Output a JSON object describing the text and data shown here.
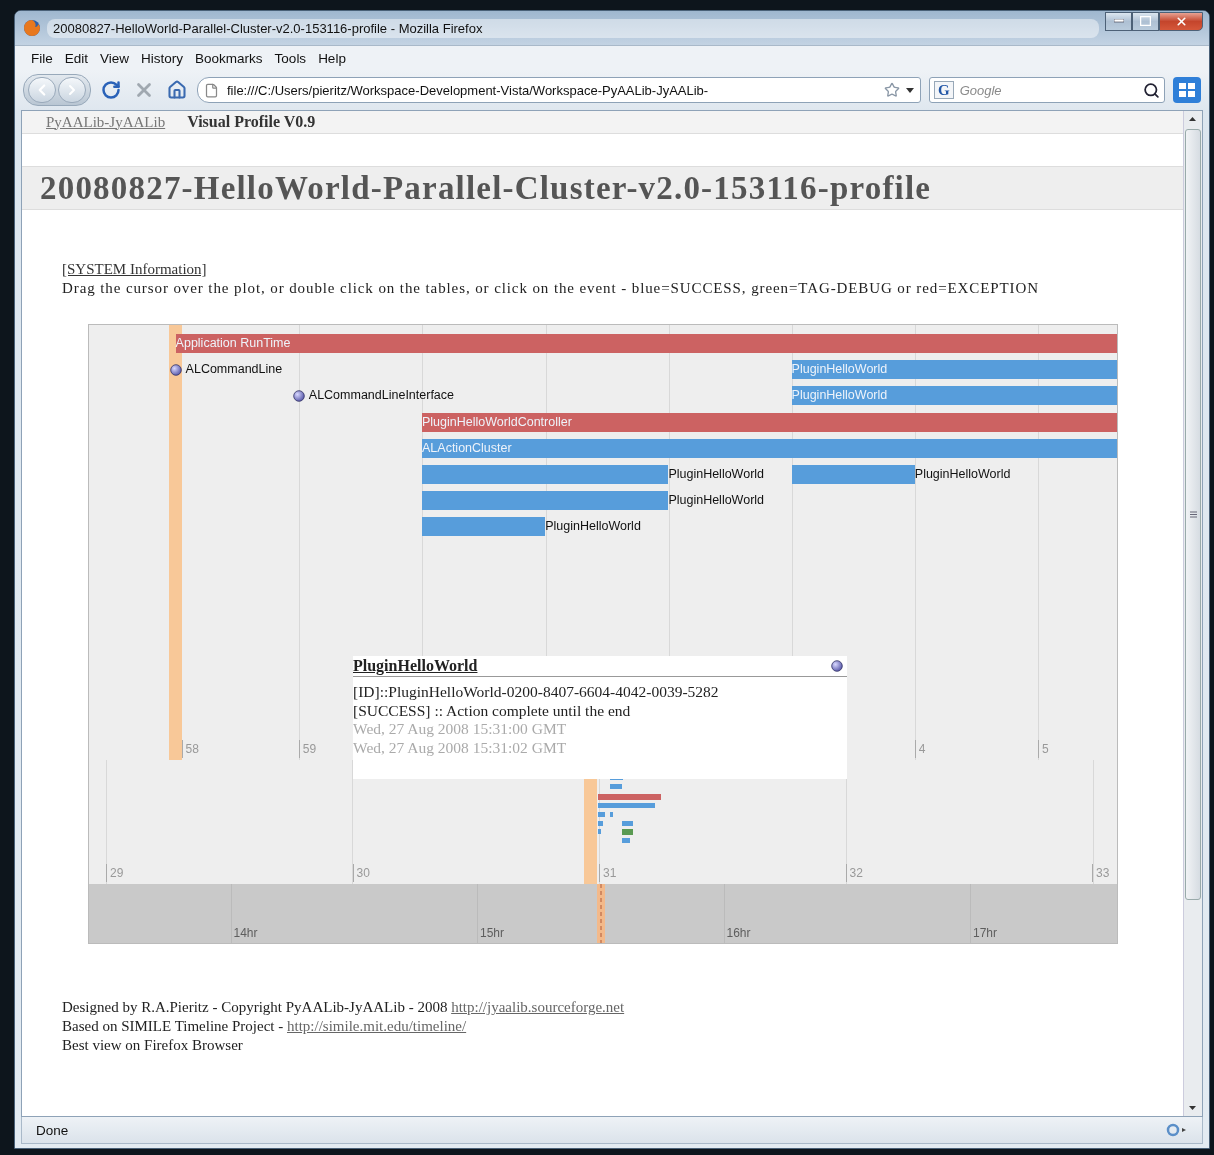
{
  "window": {
    "title": "20080827-HelloWorld-Parallel-Cluster-v2.0-153116-profile - Mozilla Firefox"
  },
  "menu": [
    "File",
    "Edit",
    "View",
    "History",
    "Bookmarks",
    "Tools",
    "Help"
  ],
  "navigation": {
    "url": "file:///C:/Users/pieritz/Workspace-Development-Vista/Workspace-PyAALib-JyAALib-",
    "search_engine": "G",
    "search_placeholder": "Google"
  },
  "page": {
    "nav_link": "PyAALib-JyAALib",
    "nav_title": "Visual Profile V0.9",
    "heading": "20080827-HelloWorld-Parallel-Cluster-v2.0-153116-profile",
    "system_link": "[SYSTEM Information]",
    "instructions": "Drag the cursor over the plot, or double click on the tables, or click on the event - blue=SUCCESS, green=TAG-DEBUG or red=EXCEPTION",
    "timeline": {
      "tracks": [
        {
          "events": [
            {
              "kind": "duration",
              "label": "Application RunTime",
              "color": "#cc6262"
            }
          ]
        },
        {
          "events": [
            {
              "kind": "instant",
              "label": "ALCommandLine"
            },
            {
              "kind": "duration",
              "label": "PluginHelloWorld",
              "color": "#579ddb"
            }
          ]
        },
        {
          "events": [
            {
              "kind": "instant",
              "label": "ALCommandLineInterface"
            },
            {
              "kind": "duration",
              "label": "PluginHelloWorld",
              "color": "#579ddb"
            }
          ]
        },
        {
          "events": [
            {
              "kind": "duration",
              "label": "PluginHelloWorldController",
              "color": "#cc6262"
            }
          ]
        },
        {
          "events": [
            {
              "kind": "duration",
              "label": "ALActionCluster",
              "color": "#579ddb"
            }
          ]
        },
        {
          "events": [
            {
              "kind": "duration",
              "label": "PluginHelloWorld",
              "color": "#579ddb"
            },
            {
              "kind": "duration",
              "label": "PluginHelloWorld",
              "color": "#579ddb"
            }
          ]
        },
        {
          "events": [
            {
              "kind": "duration",
              "label": "PluginHelloWorld",
              "color": "#579ddb"
            }
          ]
        },
        {
          "events": [
            {
              "kind": "duration",
              "label": "PluginHelloWorld",
              "color": "#579ddb"
            }
          ]
        }
      ],
      "second_ticks": [
        "58",
        "59",
        "4",
        "5"
      ],
      "minute_ticks": [
        "29",
        "30",
        "31",
        "32",
        "33"
      ],
      "hour_ticks": [
        "14hr",
        "15hr",
        "16hr",
        "17hr"
      ],
      "popup": {
        "title": "PluginHelloWorld",
        "lines": [
          {
            "kind": "detail",
            "text": "[ID]::PluginHelloWorld-0200-8407-6604-4042-0039-5282"
          },
          {
            "kind": "detail",
            "text": "[SUCCESS] :: Action complete until the end"
          },
          {
            "kind": "date",
            "text": "Wed, 27 Aug 2008 15:31:00 GMT"
          },
          {
            "kind": "date",
            "text": "Wed, 27 Aug 2008 15:31:02 GMT"
          }
        ]
      }
    },
    "footer": [
      {
        "text": "Designed by R.A.Pieritz - Copyright PyAALib-JyAALib - 2008",
        "link": "http://jyaalib.sourceforge.net"
      },
      {
        "text": "Based on SIMILE Timeline Project -",
        "link": "http://simile.mit.edu/timeline/"
      },
      {
        "text": "Best view on Firefox Browser"
      }
    ]
  },
  "status_bar": "Done"
}
